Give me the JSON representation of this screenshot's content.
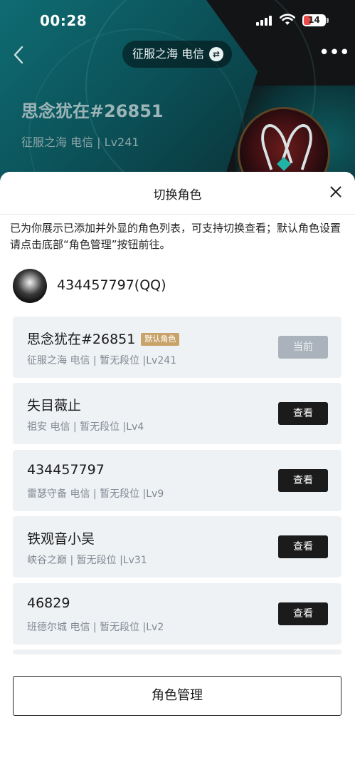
{
  "status_bar": {
    "time": "00:28",
    "battery": "14"
  },
  "header": {
    "server_pill": "征服之海 电信",
    "role_name": "思念犹在#26851",
    "role_sub": "征服之海 电信 | Lv241"
  },
  "sheet": {
    "title": "切换角色",
    "description": "已为你展示已添加并外显的角色列表，可支持切换查看；默认角色设置请点击底部“角色管理”按钮前往。",
    "account": "434457797(QQ)",
    "roles": [
      {
        "name": "思念犹在#26851",
        "tag": "默认角色",
        "meta": "征服之海 电信 | 暂无段位 |Lv241",
        "action": "当前"
      },
      {
        "name": "失目薇止",
        "meta": "祖安 电信 | 暂无段位 |Lv4",
        "action": "查看"
      },
      {
        "name": "434457797",
        "meta": "雷瑟守备 电信 | 暂无段位 |Lv9",
        "action": "查看"
      },
      {
        "name": "铁观音小吴",
        "meta": "峡谷之巅 | 暂无段位 |Lv31",
        "action": "查看"
      },
      {
        "name": "46829",
        "meta": "班德尔城 电信 | 暂无段位 |Lv2",
        "action": "查看"
      }
    ],
    "manage_button": "角色管理"
  }
}
